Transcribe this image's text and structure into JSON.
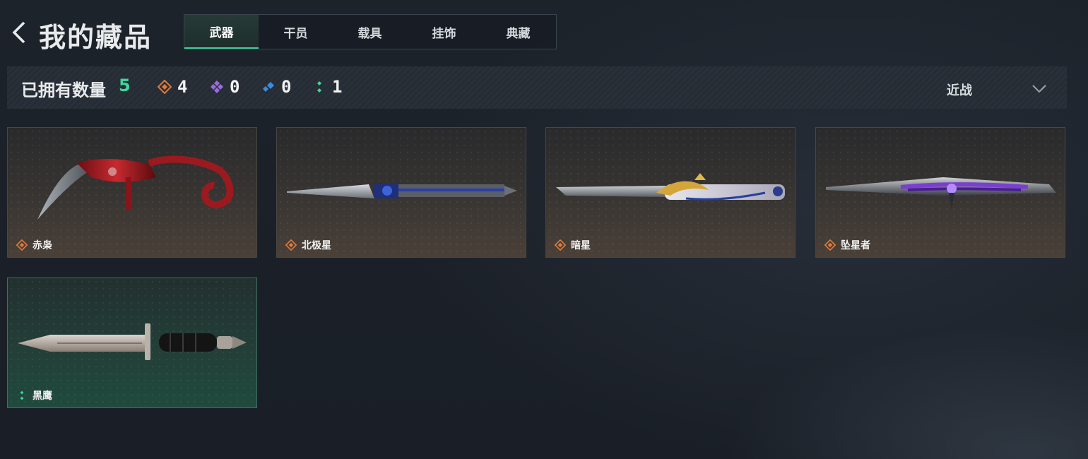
{
  "header": {
    "title": "我的藏品",
    "tabs": [
      {
        "label": "武器",
        "active": true
      },
      {
        "label": "干员",
        "active": false
      },
      {
        "label": "载具",
        "active": false
      },
      {
        "label": "挂饰",
        "active": false
      },
      {
        "label": "典藏",
        "active": false
      }
    ]
  },
  "stats": {
    "owned_label": "已拥有数量",
    "owned_count": "5",
    "rarities": [
      {
        "icon": "orange-diamond-icon",
        "color": "#e07a3c",
        "count": "4"
      },
      {
        "icon": "purple-diamond-icon",
        "color": "#9a6ce0",
        "count": "0"
      },
      {
        "icon": "blue-diamond-icon",
        "color": "#3b8be0",
        "count": "0"
      },
      {
        "icon": "green-dots-icon",
        "color": "#3fd69a",
        "count": "1"
      }
    ]
  },
  "filter": {
    "selected": "近战"
  },
  "items": [
    {
      "name": "赤枭",
      "rarity_color": "#e07a3c"
    },
    {
      "name": "北极星",
      "rarity_color": "#e07a3c"
    },
    {
      "name": "暗星",
      "rarity_color": "#e07a3c"
    },
    {
      "name": "坠星者",
      "rarity_color": "#e07a3c"
    },
    {
      "name": "黑鹰",
      "rarity_color": "#3fd69a"
    }
  ],
  "colors": {
    "accent": "#3fd69a",
    "orange": "#e07a3c"
  }
}
